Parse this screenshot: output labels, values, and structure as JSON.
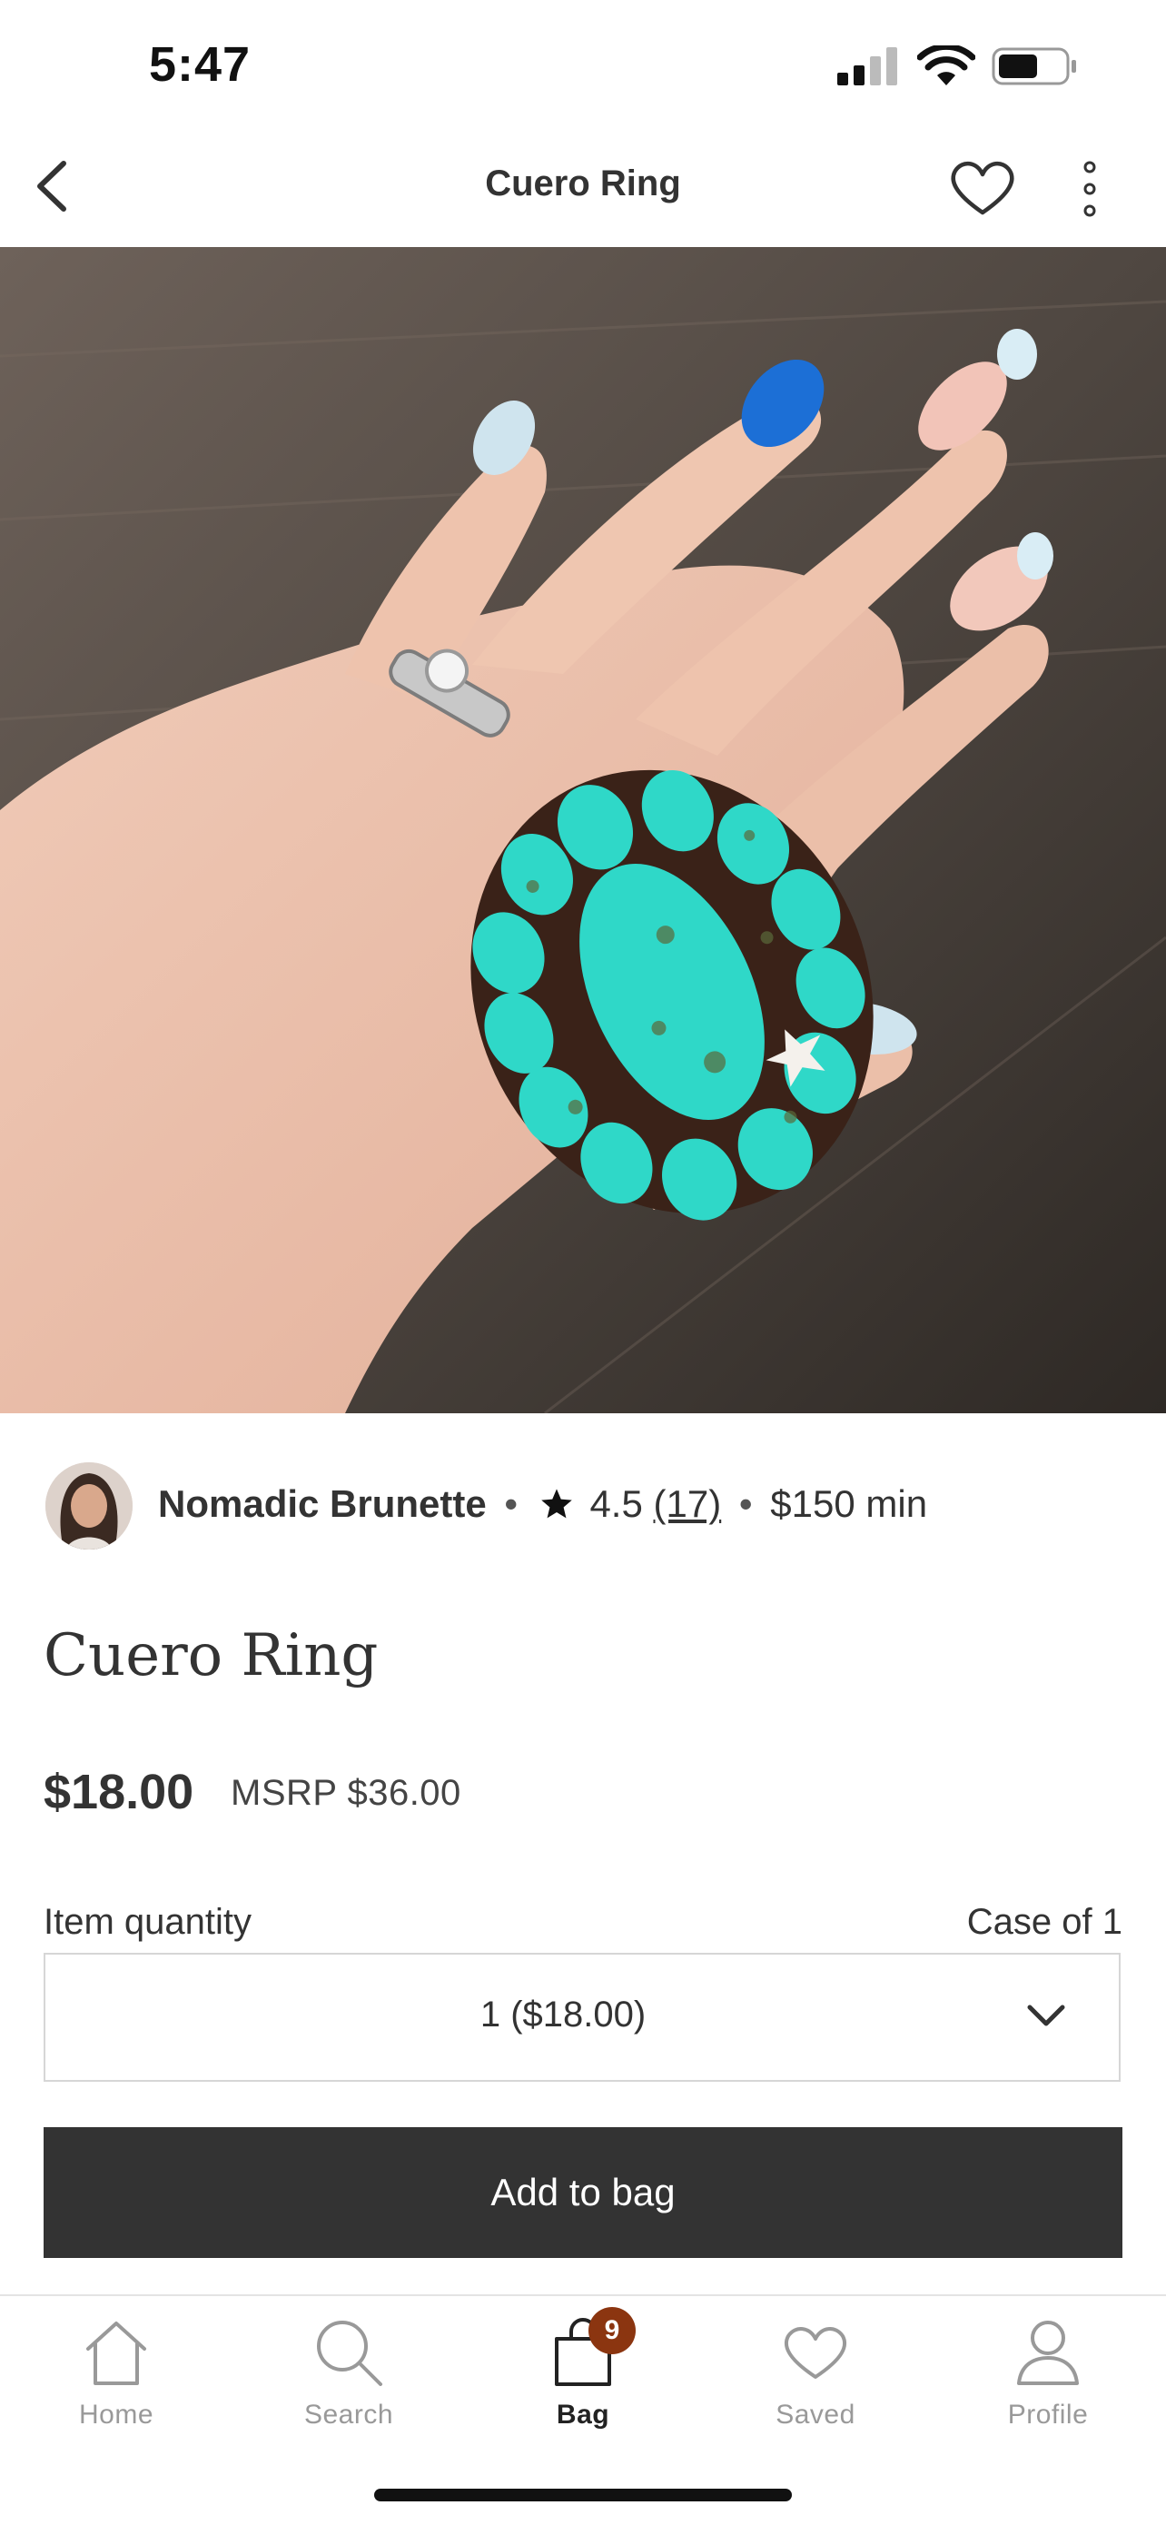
{
  "status_bar": {
    "time": "5:47"
  },
  "nav": {
    "title": "Cuero Ring"
  },
  "seller": {
    "name": "Nomadic Brunette",
    "rating": "4.5",
    "rating_count": "(17)",
    "minimum": "$150 min",
    "separator": "•"
  },
  "product": {
    "title": "Cuero Ring",
    "price": "$18.00",
    "msrp": "MSRP $36.00"
  },
  "quantity": {
    "label": "Item quantity",
    "case": "Case of 1",
    "selected": "1 ($18.00)"
  },
  "actions": {
    "add_to_bag": "Add to bag"
  },
  "tabs": [
    {
      "label": "Home",
      "icon": "home-icon"
    },
    {
      "label": "Search",
      "icon": "search-icon"
    },
    {
      "label": "Bag",
      "icon": "bag-icon",
      "badge": "9"
    },
    {
      "label": "Saved",
      "icon": "heart-icon"
    },
    {
      "label": "Profile",
      "icon": "profile-icon"
    }
  ],
  "colors": {
    "button_bg": "#333333",
    "badge_bg": "#8b3510",
    "turquoise": "#2fd8c8"
  }
}
